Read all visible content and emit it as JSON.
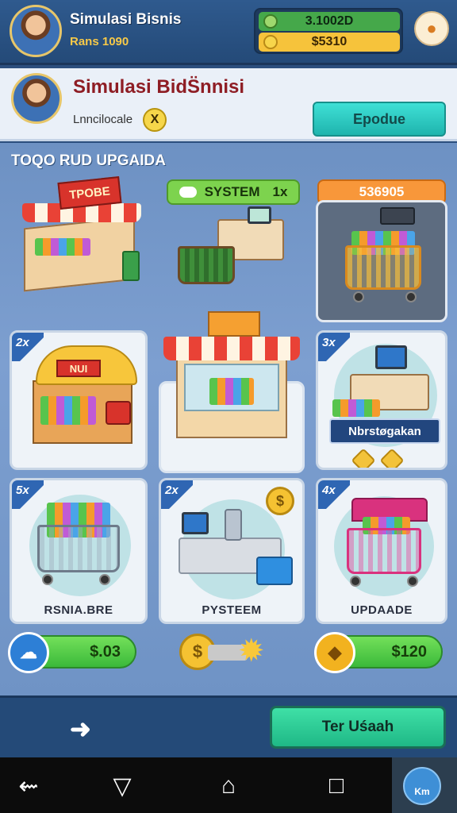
{
  "topbar": {
    "title": "Simulasi Bisnis",
    "subtitle": "Rans 1090",
    "money_primary": "3.1002D",
    "money_secondary": "$5310",
    "menu_icon": "cookie-icon"
  },
  "header_card": {
    "title": "Simulasi BidS̈nnisi",
    "subtitle": "Lnncilocale",
    "badge": "X",
    "update_label": "Epodue"
  },
  "main": {
    "section_title": "TOQO RUD UPGAIDA",
    "system_tag": {
      "label": "SYSTEM",
      "multiplier": "1x"
    },
    "price_tag": "536905",
    "shop_sign": "TPOBE",
    "stall_sign": "NUI",
    "tiles": [
      {
        "badge": "2x",
        "name": "yellow-stall"
      },
      {
        "badge": "",
        "name": "market-stand"
      },
      {
        "badge": "3x",
        "name": "computer-desk",
        "inset_label": "Nbrstøgakan"
      },
      {
        "badge": "5x",
        "label": "RSNIA.BRE"
      },
      {
        "badge": "2x",
        "label": "PYSTEEM"
      },
      {
        "badge": "4x",
        "label": "UPDAADE"
      }
    ],
    "chips": [
      {
        "value": "$.03",
        "icon": "cloud-icon",
        "color": "#2d7fd6"
      },
      {
        "value": "$"
      },
      {
        "value": "$120",
        "icon": "folder-coin-icon",
        "color": "#f2b21f"
      }
    ]
  },
  "footer": {
    "back_icon": "back-arrow-icon",
    "action_label": "Ter Uśaah"
  },
  "sysnav": {
    "back_icon": "system-back-icon",
    "home_icon": "home-icon",
    "recent_icon": "recent-apps-icon",
    "badge_label": "Km"
  }
}
